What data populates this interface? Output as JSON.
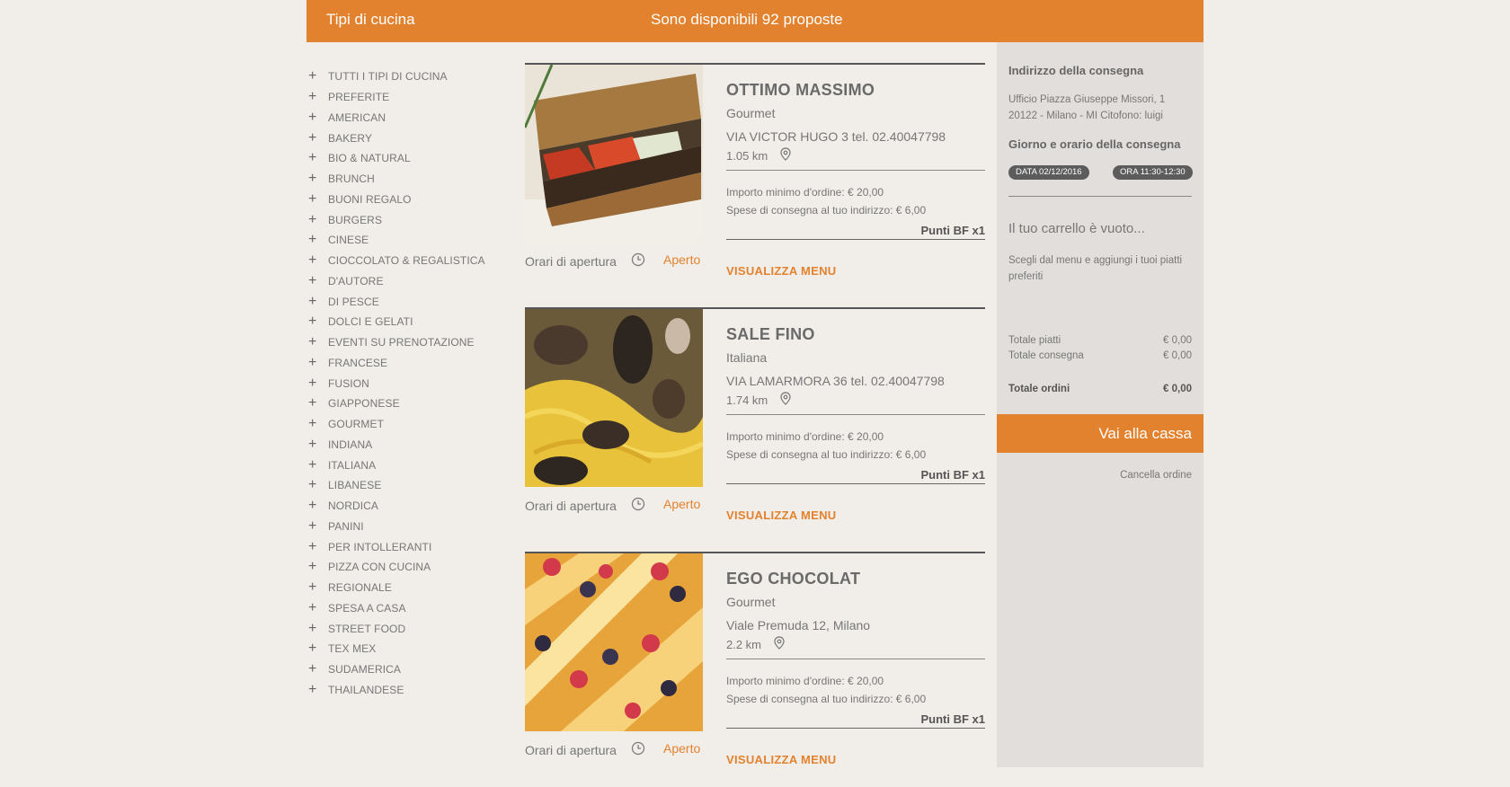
{
  "header": {
    "left_title": "Tipi di cucina",
    "center_title": "Sono disponibili 92 proposte"
  },
  "categories": [
    "TUTTI I TIPI DI CUCINA",
    "PREFERITE",
    "AMERICAN",
    "BAKERY",
    "BIO & NATURAL",
    "BRUNCH",
    "BUONI REGALO",
    "BURGERS",
    "CINESE",
    "CIOCCOLATO & REGALISTICA",
    "D'AUTORE",
    "DI PESCE",
    "DOLCI E GELATI",
    "EVENTI SU PRENOTAZIONE",
    "FRANCESE",
    "FUSION",
    "GIAPPONESE",
    "GOURMET",
    "INDIANA",
    "ITALIANA",
    "LIBANESE",
    "NORDICA",
    "PANINI",
    "PER INTOLLERANTI",
    "PIZZA CON CUCINA",
    "REGIONALE",
    "SPESA A CASA",
    "STREET FOOD",
    "TEX MEX",
    "SUDAMERICA",
    "THAILANDESE"
  ],
  "restaurants": [
    {
      "name": "OTTIMO MASSIMO",
      "cuisine": "Gourmet",
      "address": "VIA VICTOR HUGO 3 tel. 02.40047798",
      "distance": "1.05 km",
      "min_order": "Importo minimo d'ordine: € 20,00",
      "delivery": "Spese di consegna al tuo indirizzo: € 6,00",
      "points": "Punti BF x1",
      "hours_label": "Orari di apertura",
      "status": "Aperto",
      "menu_label": "VISUALIZZA MENU",
      "image_icon": "sandwich-photo"
    },
    {
      "name": "SALE FINO",
      "cuisine": "Italiana",
      "address": "VIA LAMARMORA 36 tel. 02.40047798",
      "distance": "1.74 km",
      "min_order": "Importo minimo d'ordine: € 20,00",
      "delivery": "Spese di consegna al tuo indirizzo: € 6,00",
      "points": "Punti BF x1",
      "hours_label": "Orari di apertura",
      "status": "Aperto",
      "menu_label": "VISUALIZZA MENU",
      "image_icon": "seafood-pasta-photo"
    },
    {
      "name": "EGO CHOCOLAT",
      "cuisine": "Gourmet",
      "address": "Viale Premuda 12, Milano",
      "distance": "2.2 km",
      "min_order": "Importo minimo d'ordine: € 20,00",
      "delivery": "Spese di consegna al tuo indirizzo: € 6,00",
      "points": "Punti BF x1",
      "hours_label": "Orari di apertura",
      "status": "Aperto",
      "menu_label": "VISUALIZZA MENU",
      "image_icon": "pastry-photo"
    }
  ],
  "panel": {
    "address_title": "Indirizzo della consegna",
    "address_text": "Ufficio Piazza Giuseppe Missori, 1 20122 - Milano - MI Citofono: luigi",
    "time_title": "Giorno e orario della consegna",
    "date_badge": "DATA 02/12/2016",
    "time_badge": "ORA 11:30-12:30",
    "cart_empty": "Il tuo carrello è vuoto...",
    "cart_hint": "Scegli dal menu e aggiungi i tuoi piatti preferiti",
    "tot_piatti_label": "Totale piatti",
    "tot_piatti_value": "€ 0,00",
    "tot_consegna_label": "Totale consegna",
    "tot_consegna_value": "€ 0,00",
    "tot_ordini_label": "Totale ordini",
    "tot_ordini_value": "€ 0,00",
    "checkout_label": "Vai alla cassa",
    "cancel_label": "Cancella ordine"
  },
  "colors": {
    "accent": "#e3822e",
    "background": "#f1ede8",
    "panel": "#e2dedb"
  }
}
